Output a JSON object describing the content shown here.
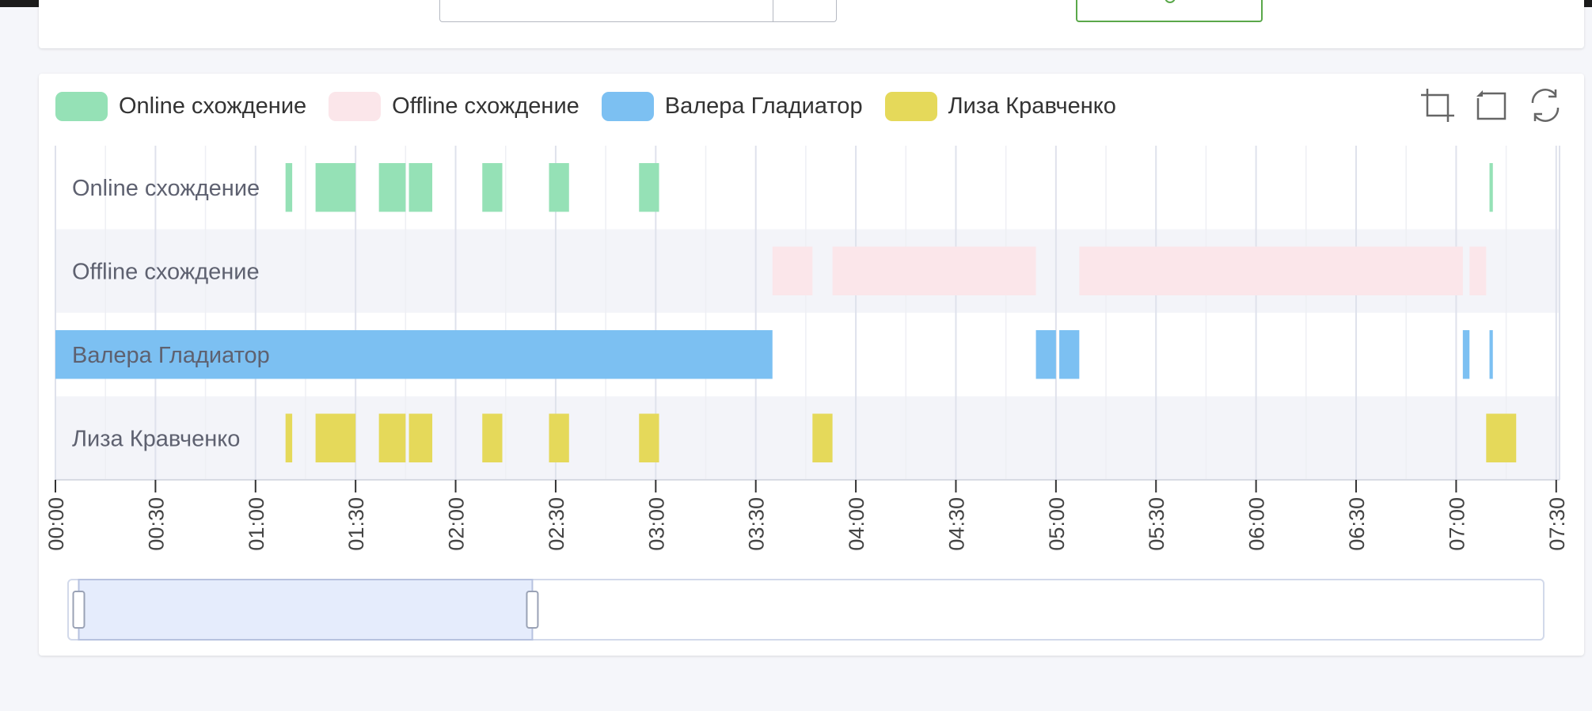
{
  "chart_data": {
    "type": "timeline",
    "legend": [
      {
        "name": "Online схождение",
        "color": "#95e1b6"
      },
      {
        "name": "Offline схождение",
        "color": "#fbe6ea"
      },
      {
        "name": "Валера Гладиатор",
        "color": "#7cc0f2"
      },
      {
        "name": "Лиза Кравченко",
        "color": "#e5d95a"
      }
    ],
    "categories": [
      "Online схождение",
      "Offline схождение",
      "Валера Гладиатор",
      "Лиза Кравченко"
    ],
    "x_ticks": [
      "00:00",
      "00:30",
      "01:00",
      "01:30",
      "02:00",
      "02:30",
      "03:00",
      "03:30",
      "04:00",
      "04:30",
      "05:00",
      "05:30",
      "06:00",
      "06:30",
      "07:00",
      "07:30"
    ],
    "xlim": [
      "00:00",
      "07:31"
    ],
    "series": [
      {
        "name": "Online схождение",
        "color": "#95e1b6",
        "intervals": [
          [
            "01:09",
            "01:11"
          ],
          [
            "01:18",
            "01:30"
          ],
          [
            "01:37",
            "01:45"
          ],
          [
            "01:46",
            "01:53"
          ],
          [
            "02:08",
            "02:14"
          ],
          [
            "02:28",
            "02:34"
          ],
          [
            "02:55",
            "03:01"
          ],
          [
            "07:10",
            "07:11"
          ]
        ]
      },
      {
        "name": "Offline схождение",
        "color": "#fbe6ea",
        "intervals": [
          [
            "03:35",
            "03:47"
          ],
          [
            "03:53",
            "04:54"
          ],
          [
            "05:07",
            "07:02"
          ],
          [
            "07:04",
            "07:09"
          ]
        ]
      },
      {
        "name": "Валера Гладиатор",
        "color": "#7cc0f2",
        "intervals": [
          [
            "00:00",
            "03:35"
          ],
          [
            "04:54",
            "05:00"
          ],
          [
            "05:01",
            "05:07"
          ],
          [
            "07:02",
            "07:04"
          ],
          [
            "07:10",
            "07:11"
          ]
        ]
      },
      {
        "name": "Лиза Кравченко",
        "color": "#e5d95a",
        "intervals": [
          [
            "01:09",
            "01:11"
          ],
          [
            "01:18",
            "01:30"
          ],
          [
            "01:37",
            "01:45"
          ],
          [
            "01:46",
            "01:53"
          ],
          [
            "02:08",
            "02:14"
          ],
          [
            "02:28",
            "02:34"
          ],
          [
            "02:55",
            "03:01"
          ],
          [
            "03:47",
            "03:53"
          ],
          [
            "07:09",
            "07:18"
          ]
        ]
      }
    ],
    "grid": true,
    "legend_position": "top-left",
    "datazoom": {
      "start": "00:07",
      "end": "02:23"
    }
  },
  "toolbox": {
    "icons": [
      "zoom-icon",
      "zoom-reset-icon",
      "restore-icon"
    ],
    "color": "#666666"
  }
}
